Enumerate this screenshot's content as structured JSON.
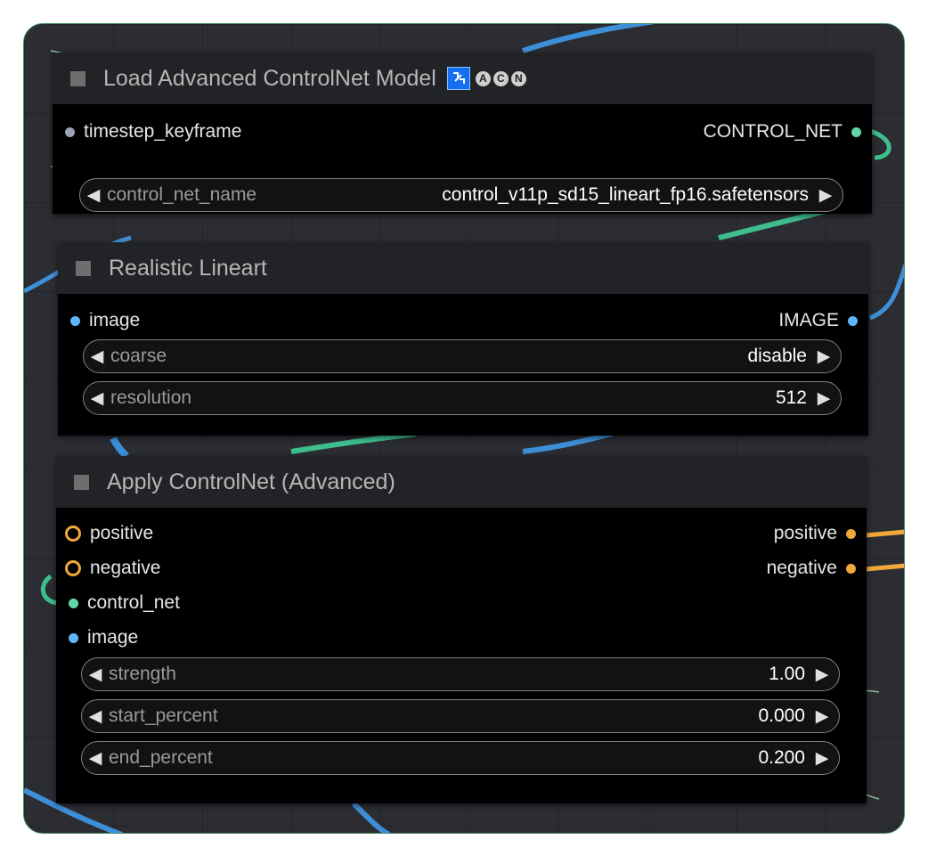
{
  "colors": {
    "model": "#5fd8a8",
    "image": "#64b5f6",
    "conditioning": "#f0a93a",
    "keyframe": "#9aa3b5"
  },
  "node_load": {
    "title": "Load Advanced ControlNet Model",
    "badges": [
      "A",
      "C",
      "N"
    ],
    "inputs": [
      "timestep_keyframe"
    ],
    "outputs": [
      "CONTROL_NET"
    ],
    "widgets": [
      {
        "name": "control_net_name",
        "value": "control_v11p_sd15_lineart_fp16.safetensors"
      }
    ]
  },
  "node_lineart": {
    "title": "Realistic Lineart",
    "inputs": [
      "image"
    ],
    "outputs": [
      "IMAGE"
    ],
    "widgets": [
      {
        "name": "coarse",
        "value": "disable"
      },
      {
        "name": "resolution",
        "value": "512"
      }
    ]
  },
  "node_apply": {
    "title": "Apply ControlNet (Advanced)",
    "inputs": [
      "positive",
      "negative",
      "control_net",
      "image"
    ],
    "outputs": [
      "positive",
      "negative"
    ],
    "widgets": [
      {
        "name": "strength",
        "value": "1.00"
      },
      {
        "name": "start_percent",
        "value": "0.000"
      },
      {
        "name": "end_percent",
        "value": "0.200"
      }
    ]
  }
}
